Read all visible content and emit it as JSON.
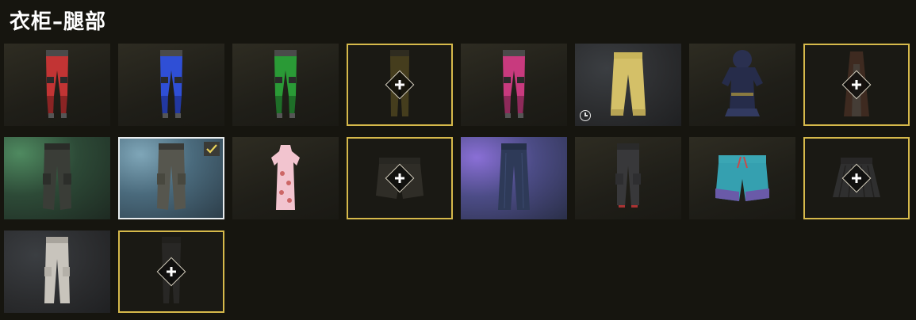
{
  "header": {
    "title": "衣柜–腿部"
  },
  "colors": {
    "empty_slot_border": "#d6b94b",
    "selected_border": "#e8ecee",
    "background": "#16150f"
  },
  "slots": [
    {
      "item": "red-armored-pants",
      "state": "owned"
    },
    {
      "item": "blue-armored-pants",
      "state": "owned"
    },
    {
      "item": "green-armored-pants",
      "state": "owned"
    },
    {
      "item": "olive-pants",
      "state": "empty-add"
    },
    {
      "item": "pink-armored-pants",
      "state": "owned"
    },
    {
      "item": "yellow-sweatpants",
      "state": "owned-timed",
      "icon": "clock-icon"
    },
    {
      "item": "dark-ninja-outfit",
      "state": "owned"
    },
    {
      "item": "brown-robe",
      "state": "empty-add"
    },
    {
      "item": "dark-cargo-pants",
      "state": "owned"
    },
    {
      "item": "grey-cargo-pants",
      "state": "selected",
      "icon": "check-icon"
    },
    {
      "item": "pink-qipao-dress",
      "state": "owned"
    },
    {
      "item": "black-shorts",
      "state": "empty-add"
    },
    {
      "item": "blue-jeans",
      "state": "owned"
    },
    {
      "item": "black-tactical-pants",
      "state": "owned"
    },
    {
      "item": "teal-shorts",
      "state": "owned"
    },
    {
      "item": "dark-pleated-skirt",
      "state": "empty-add"
    },
    {
      "item": "white-cargo-pants",
      "state": "owned"
    },
    {
      "item": "black-leggings",
      "state": "empty-add"
    }
  ]
}
